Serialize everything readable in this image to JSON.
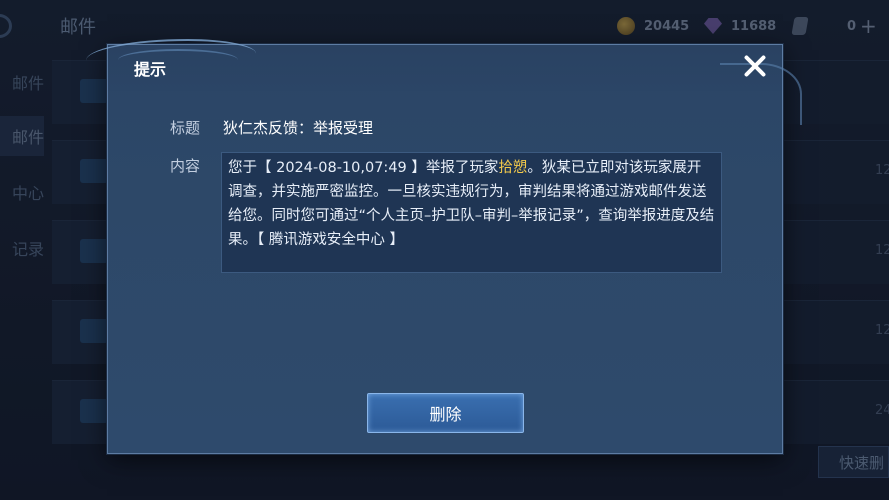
{
  "background": {
    "page_title": "邮件",
    "currencies": [
      {
        "icon": "coin-icon",
        "value": "20445"
      },
      {
        "icon": "gem-icon",
        "value": "11688"
      },
      {
        "icon": "ticket-icon",
        "value": "0"
      }
    ],
    "sidebar": [
      "邮件",
      "邮件",
      "中心",
      "记录"
    ],
    "row_dates": [
      "12",
      "12",
      "12",
      "24"
    ],
    "quick_delete": "快速删"
  },
  "dialog": {
    "title": "提示",
    "subject_label": "标题",
    "subject_value": "狄仁杰反馈：举报受理",
    "content_label": "内容",
    "content_before": "您于【 2024-08-10,07:49 】举报了玩家",
    "content_highlight": "拾愬",
    "content_after": "。狄某已立即对该玩家展开调查，并实施严密监控。一旦核实违规行为，审判结果将通过游戏邮件发送给您。同时您可通过“个人主页–护卫队–审判–举报记录”，查询举报进度及结果。【 腾讯游戏安全中心 】",
    "delete_button": "删除"
  },
  "colors": {
    "highlight": "#f2c94c",
    "dialog_bg": "#2d4868",
    "button_bg": "#3a6fb0"
  }
}
